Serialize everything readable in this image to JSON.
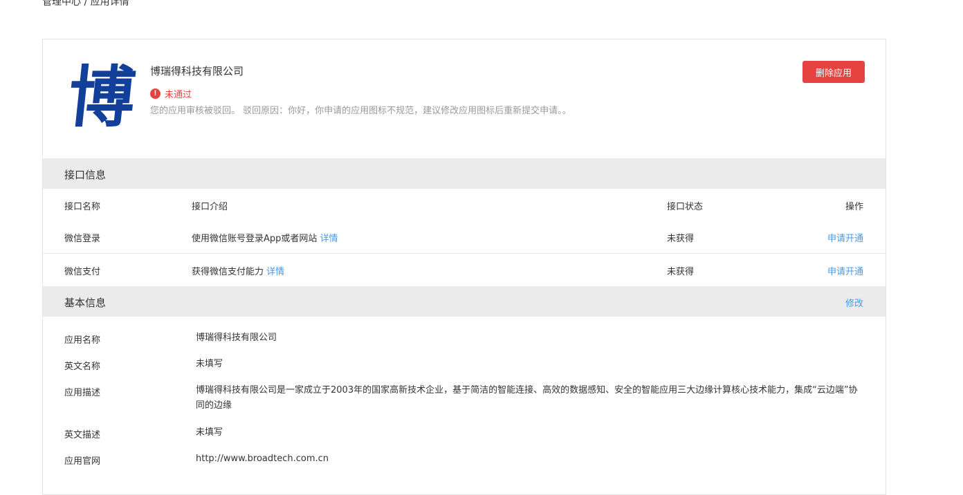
{
  "breadcrumb": "管理中心 / 应用详情",
  "app": {
    "logo_char": "博",
    "name": "博瑞得科技有限公司",
    "status": "未通过",
    "status_icon": "!",
    "reject_reason": "您的应用审核被驳回。 驳回原因：你好，你申请的应用图标不规范，建议修改应用图标后重新提交申请。。",
    "delete_label": "删除应用"
  },
  "colors": {
    "danger": "#e64340",
    "link": "#459ae9",
    "section_bg": "#ebebeb",
    "logo": "#123f9a"
  },
  "interfaces": {
    "title": "接口信息",
    "headers": {
      "name": "接口名称",
      "intro": "接口介绍",
      "status": "接口状态",
      "action": "操作"
    },
    "rows": [
      {
        "name": "微信登录",
        "intro": "使用微信账号登录App或者网站",
        "detail": "详情",
        "status": "未获得",
        "action": "申请开通"
      },
      {
        "name": "微信支付",
        "intro": "获得微信支付能力",
        "detail": "详情",
        "status": "未获得",
        "action": "申请开通"
      }
    ]
  },
  "basic": {
    "title": "基本信息",
    "edit_label": "修改",
    "fields": [
      {
        "label": "应用名称",
        "value": "博瑞得科技有限公司"
      },
      {
        "label": "英文名称",
        "value": "未填写"
      },
      {
        "label": "应用描述",
        "value": "博瑞得科技有限公司是一家成立于2003年的国家高新技术企业，基于简洁的智能连接、高效的数据感知、安全的智能应用三大边缘计算核心技术能力，集成“云边端”协同的边缘"
      },
      {
        "label": "英文描述",
        "value": "未填写"
      },
      {
        "label": "应用官网",
        "value": "http://www.broadtech.com.cn"
      }
    ]
  }
}
